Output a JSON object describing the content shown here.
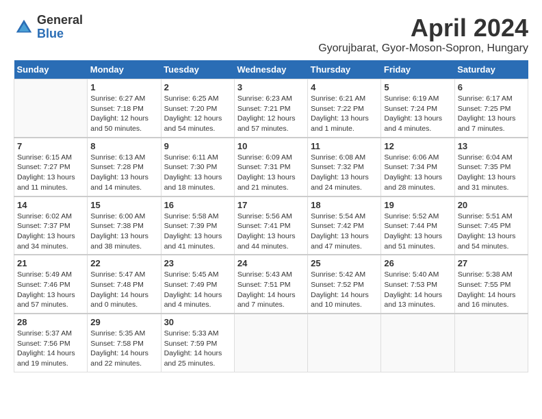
{
  "logo": {
    "general": "General",
    "blue": "Blue"
  },
  "title": {
    "month": "April 2024",
    "location": "Gyorujbarat, Gyor-Moson-Sopron, Hungary"
  },
  "headers": [
    "Sunday",
    "Monday",
    "Tuesday",
    "Wednesday",
    "Thursday",
    "Friday",
    "Saturday"
  ],
  "weeks": [
    [
      {
        "day": "",
        "sunrise": "",
        "sunset": "",
        "daylight": ""
      },
      {
        "day": "1",
        "sunrise": "Sunrise: 6:27 AM",
        "sunset": "Sunset: 7:18 PM",
        "daylight": "Daylight: 12 hours and 50 minutes."
      },
      {
        "day": "2",
        "sunrise": "Sunrise: 6:25 AM",
        "sunset": "Sunset: 7:20 PM",
        "daylight": "Daylight: 12 hours and 54 minutes."
      },
      {
        "day": "3",
        "sunrise": "Sunrise: 6:23 AM",
        "sunset": "Sunset: 7:21 PM",
        "daylight": "Daylight: 12 hours and 57 minutes."
      },
      {
        "day": "4",
        "sunrise": "Sunrise: 6:21 AM",
        "sunset": "Sunset: 7:22 PM",
        "daylight": "Daylight: 13 hours and 1 minute."
      },
      {
        "day": "5",
        "sunrise": "Sunrise: 6:19 AM",
        "sunset": "Sunset: 7:24 PM",
        "daylight": "Daylight: 13 hours and 4 minutes."
      },
      {
        "day": "6",
        "sunrise": "Sunrise: 6:17 AM",
        "sunset": "Sunset: 7:25 PM",
        "daylight": "Daylight: 13 hours and 7 minutes."
      }
    ],
    [
      {
        "day": "7",
        "sunrise": "Sunrise: 6:15 AM",
        "sunset": "Sunset: 7:27 PM",
        "daylight": "Daylight: 13 hours and 11 minutes."
      },
      {
        "day": "8",
        "sunrise": "Sunrise: 6:13 AM",
        "sunset": "Sunset: 7:28 PM",
        "daylight": "Daylight: 13 hours and 14 minutes."
      },
      {
        "day": "9",
        "sunrise": "Sunrise: 6:11 AM",
        "sunset": "Sunset: 7:30 PM",
        "daylight": "Daylight: 13 hours and 18 minutes."
      },
      {
        "day": "10",
        "sunrise": "Sunrise: 6:09 AM",
        "sunset": "Sunset: 7:31 PM",
        "daylight": "Daylight: 13 hours and 21 minutes."
      },
      {
        "day": "11",
        "sunrise": "Sunrise: 6:08 AM",
        "sunset": "Sunset: 7:32 PM",
        "daylight": "Daylight: 13 hours and 24 minutes."
      },
      {
        "day": "12",
        "sunrise": "Sunrise: 6:06 AM",
        "sunset": "Sunset: 7:34 PM",
        "daylight": "Daylight: 13 hours and 28 minutes."
      },
      {
        "day": "13",
        "sunrise": "Sunrise: 6:04 AM",
        "sunset": "Sunset: 7:35 PM",
        "daylight": "Daylight: 13 hours and 31 minutes."
      }
    ],
    [
      {
        "day": "14",
        "sunrise": "Sunrise: 6:02 AM",
        "sunset": "Sunset: 7:37 PM",
        "daylight": "Daylight: 13 hours and 34 minutes."
      },
      {
        "day": "15",
        "sunrise": "Sunrise: 6:00 AM",
        "sunset": "Sunset: 7:38 PM",
        "daylight": "Daylight: 13 hours and 38 minutes."
      },
      {
        "day": "16",
        "sunrise": "Sunrise: 5:58 AM",
        "sunset": "Sunset: 7:39 PM",
        "daylight": "Daylight: 13 hours and 41 minutes."
      },
      {
        "day": "17",
        "sunrise": "Sunrise: 5:56 AM",
        "sunset": "Sunset: 7:41 PM",
        "daylight": "Daylight: 13 hours and 44 minutes."
      },
      {
        "day": "18",
        "sunrise": "Sunrise: 5:54 AM",
        "sunset": "Sunset: 7:42 PM",
        "daylight": "Daylight: 13 hours and 47 minutes."
      },
      {
        "day": "19",
        "sunrise": "Sunrise: 5:52 AM",
        "sunset": "Sunset: 7:44 PM",
        "daylight": "Daylight: 13 hours and 51 minutes."
      },
      {
        "day": "20",
        "sunrise": "Sunrise: 5:51 AM",
        "sunset": "Sunset: 7:45 PM",
        "daylight": "Daylight: 13 hours and 54 minutes."
      }
    ],
    [
      {
        "day": "21",
        "sunrise": "Sunrise: 5:49 AM",
        "sunset": "Sunset: 7:46 PM",
        "daylight": "Daylight: 13 hours and 57 minutes."
      },
      {
        "day": "22",
        "sunrise": "Sunrise: 5:47 AM",
        "sunset": "Sunset: 7:48 PM",
        "daylight": "Daylight: 14 hours and 0 minutes."
      },
      {
        "day": "23",
        "sunrise": "Sunrise: 5:45 AM",
        "sunset": "Sunset: 7:49 PM",
        "daylight": "Daylight: 14 hours and 4 minutes."
      },
      {
        "day": "24",
        "sunrise": "Sunrise: 5:43 AM",
        "sunset": "Sunset: 7:51 PM",
        "daylight": "Daylight: 14 hours and 7 minutes."
      },
      {
        "day": "25",
        "sunrise": "Sunrise: 5:42 AM",
        "sunset": "Sunset: 7:52 PM",
        "daylight": "Daylight: 14 hours and 10 minutes."
      },
      {
        "day": "26",
        "sunrise": "Sunrise: 5:40 AM",
        "sunset": "Sunset: 7:53 PM",
        "daylight": "Daylight: 14 hours and 13 minutes."
      },
      {
        "day": "27",
        "sunrise": "Sunrise: 5:38 AM",
        "sunset": "Sunset: 7:55 PM",
        "daylight": "Daylight: 14 hours and 16 minutes."
      }
    ],
    [
      {
        "day": "28",
        "sunrise": "Sunrise: 5:37 AM",
        "sunset": "Sunset: 7:56 PM",
        "daylight": "Daylight: 14 hours and 19 minutes."
      },
      {
        "day": "29",
        "sunrise": "Sunrise: 5:35 AM",
        "sunset": "Sunset: 7:58 PM",
        "daylight": "Daylight: 14 hours and 22 minutes."
      },
      {
        "day": "30",
        "sunrise": "Sunrise: 5:33 AM",
        "sunset": "Sunset: 7:59 PM",
        "daylight": "Daylight: 14 hours and 25 minutes."
      },
      {
        "day": "",
        "sunrise": "",
        "sunset": "",
        "daylight": ""
      },
      {
        "day": "",
        "sunrise": "",
        "sunset": "",
        "daylight": ""
      },
      {
        "day": "",
        "sunrise": "",
        "sunset": "",
        "daylight": ""
      },
      {
        "day": "",
        "sunrise": "",
        "sunset": "",
        "daylight": ""
      }
    ]
  ]
}
